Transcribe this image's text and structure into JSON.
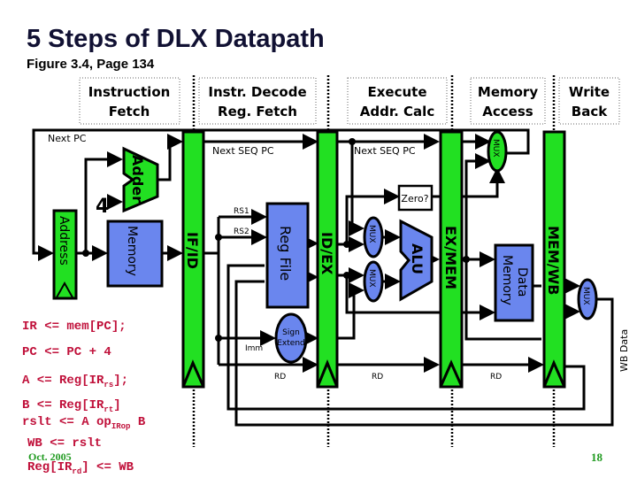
{
  "title": "5 Steps of DLX Datapath",
  "subtitle": "Figure 3.4, Page 134",
  "stages": [
    {
      "line1": "Instruction",
      "line2": "Fetch"
    },
    {
      "line1": "Instr. Decode",
      "line2": "Reg. Fetch"
    },
    {
      "line1": "Execute",
      "line2": "Addr. Calc"
    },
    {
      "line1": "Memory",
      "line2": "Access"
    },
    {
      "line1": "Write",
      "line2": "Back"
    }
  ],
  "labels": {
    "next_pc": "Next PC",
    "next_seq_pc_1": "Next SEQ PC",
    "next_seq_pc_2": "Next SEQ PC",
    "four": "4",
    "adder": "Adder",
    "address": "Address",
    "memory": "Memory",
    "if_id": "IF/ID",
    "rs1": "RS1",
    "rs2": "RS2",
    "reg_file": "Reg File",
    "imm": "Imm",
    "sign": "Sign",
    "extend": "Extend",
    "id_ex": "ID/EX",
    "zero": "Zero?",
    "mux": "MUX",
    "alu": "ALU",
    "ex_mem": "EX/MEM",
    "data": "Data",
    "data_memory": "Memory",
    "mem_wb": "MEM/WB",
    "rd": "RD",
    "wb_data": "WB Data"
  },
  "code": [
    {
      "pre": "IR <= mem[PC];",
      "sub": "",
      "post": ""
    },
    {
      "pre": "PC <= PC + 4",
      "sub": "",
      "post": ""
    },
    {
      "pre": "A <= Reg[IR",
      "sub": "rs",
      "post": "];"
    },
    {
      "pre": "B <= Reg[IR",
      "sub": "rt",
      "post": "]"
    },
    {
      "pre": "rslt <= A op",
      "sub": "IRop",
      "post": " B"
    },
    {
      "pre": "WB <= rslt",
      "sub": "",
      "post": ""
    },
    {
      "pre": "Reg[IR",
      "sub": "rd",
      "post": "] <= WB"
    }
  ],
  "footer": {
    "date": "Oct. 2005",
    "page": "18"
  },
  "colors": {
    "register": "#22e022",
    "unit": "#6a86ee",
    "code": "#c0103a",
    "footer": "#1f9a1f"
  }
}
